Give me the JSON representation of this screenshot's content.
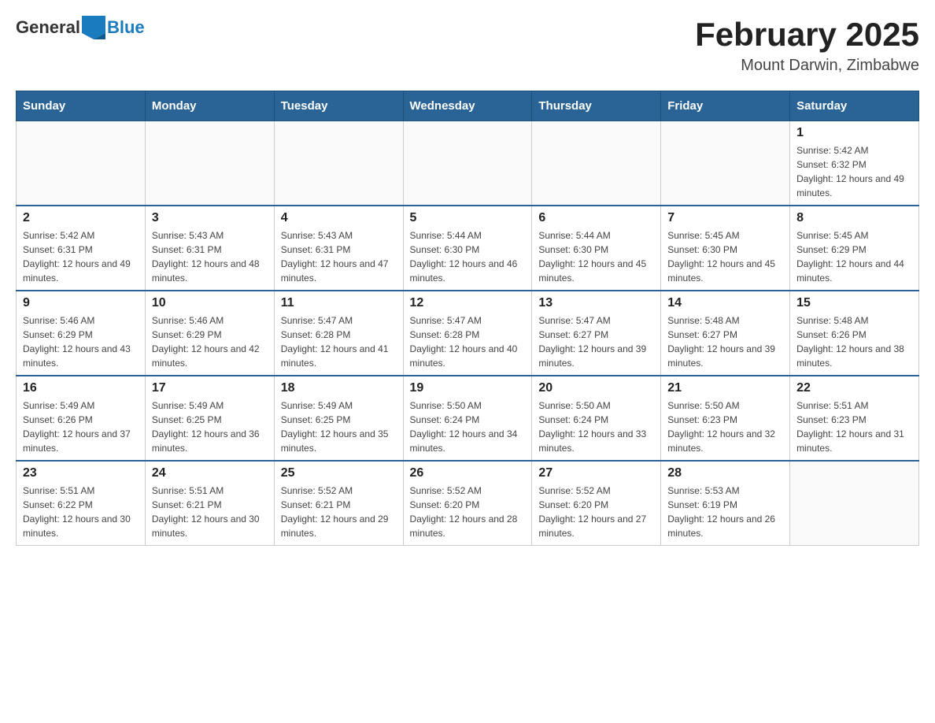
{
  "header": {
    "logo_text_general": "General",
    "logo_text_blue": "Blue",
    "month_year": "February 2025",
    "location": "Mount Darwin, Zimbabwe"
  },
  "days_of_week": [
    "Sunday",
    "Monday",
    "Tuesday",
    "Wednesday",
    "Thursday",
    "Friday",
    "Saturday"
  ],
  "weeks": [
    [
      {
        "day": "",
        "info": ""
      },
      {
        "day": "",
        "info": ""
      },
      {
        "day": "",
        "info": ""
      },
      {
        "day": "",
        "info": ""
      },
      {
        "day": "",
        "info": ""
      },
      {
        "day": "",
        "info": ""
      },
      {
        "day": "1",
        "info": "Sunrise: 5:42 AM\nSunset: 6:32 PM\nDaylight: 12 hours and 49 minutes."
      }
    ],
    [
      {
        "day": "2",
        "info": "Sunrise: 5:42 AM\nSunset: 6:31 PM\nDaylight: 12 hours and 49 minutes."
      },
      {
        "day": "3",
        "info": "Sunrise: 5:43 AM\nSunset: 6:31 PM\nDaylight: 12 hours and 48 minutes."
      },
      {
        "day": "4",
        "info": "Sunrise: 5:43 AM\nSunset: 6:31 PM\nDaylight: 12 hours and 47 minutes."
      },
      {
        "day": "5",
        "info": "Sunrise: 5:44 AM\nSunset: 6:30 PM\nDaylight: 12 hours and 46 minutes."
      },
      {
        "day": "6",
        "info": "Sunrise: 5:44 AM\nSunset: 6:30 PM\nDaylight: 12 hours and 45 minutes."
      },
      {
        "day": "7",
        "info": "Sunrise: 5:45 AM\nSunset: 6:30 PM\nDaylight: 12 hours and 45 minutes."
      },
      {
        "day": "8",
        "info": "Sunrise: 5:45 AM\nSunset: 6:29 PM\nDaylight: 12 hours and 44 minutes."
      }
    ],
    [
      {
        "day": "9",
        "info": "Sunrise: 5:46 AM\nSunset: 6:29 PM\nDaylight: 12 hours and 43 minutes."
      },
      {
        "day": "10",
        "info": "Sunrise: 5:46 AM\nSunset: 6:29 PM\nDaylight: 12 hours and 42 minutes."
      },
      {
        "day": "11",
        "info": "Sunrise: 5:47 AM\nSunset: 6:28 PM\nDaylight: 12 hours and 41 minutes."
      },
      {
        "day": "12",
        "info": "Sunrise: 5:47 AM\nSunset: 6:28 PM\nDaylight: 12 hours and 40 minutes."
      },
      {
        "day": "13",
        "info": "Sunrise: 5:47 AM\nSunset: 6:27 PM\nDaylight: 12 hours and 39 minutes."
      },
      {
        "day": "14",
        "info": "Sunrise: 5:48 AM\nSunset: 6:27 PM\nDaylight: 12 hours and 39 minutes."
      },
      {
        "day": "15",
        "info": "Sunrise: 5:48 AM\nSunset: 6:26 PM\nDaylight: 12 hours and 38 minutes."
      }
    ],
    [
      {
        "day": "16",
        "info": "Sunrise: 5:49 AM\nSunset: 6:26 PM\nDaylight: 12 hours and 37 minutes."
      },
      {
        "day": "17",
        "info": "Sunrise: 5:49 AM\nSunset: 6:25 PM\nDaylight: 12 hours and 36 minutes."
      },
      {
        "day": "18",
        "info": "Sunrise: 5:49 AM\nSunset: 6:25 PM\nDaylight: 12 hours and 35 minutes."
      },
      {
        "day": "19",
        "info": "Sunrise: 5:50 AM\nSunset: 6:24 PM\nDaylight: 12 hours and 34 minutes."
      },
      {
        "day": "20",
        "info": "Sunrise: 5:50 AM\nSunset: 6:24 PM\nDaylight: 12 hours and 33 minutes."
      },
      {
        "day": "21",
        "info": "Sunrise: 5:50 AM\nSunset: 6:23 PM\nDaylight: 12 hours and 32 minutes."
      },
      {
        "day": "22",
        "info": "Sunrise: 5:51 AM\nSunset: 6:23 PM\nDaylight: 12 hours and 31 minutes."
      }
    ],
    [
      {
        "day": "23",
        "info": "Sunrise: 5:51 AM\nSunset: 6:22 PM\nDaylight: 12 hours and 30 minutes."
      },
      {
        "day": "24",
        "info": "Sunrise: 5:51 AM\nSunset: 6:21 PM\nDaylight: 12 hours and 30 minutes."
      },
      {
        "day": "25",
        "info": "Sunrise: 5:52 AM\nSunset: 6:21 PM\nDaylight: 12 hours and 29 minutes."
      },
      {
        "day": "26",
        "info": "Sunrise: 5:52 AM\nSunset: 6:20 PM\nDaylight: 12 hours and 28 minutes."
      },
      {
        "day": "27",
        "info": "Sunrise: 5:52 AM\nSunset: 6:20 PM\nDaylight: 12 hours and 27 minutes."
      },
      {
        "day": "28",
        "info": "Sunrise: 5:53 AM\nSunset: 6:19 PM\nDaylight: 12 hours and 26 minutes."
      },
      {
        "day": "",
        "info": ""
      }
    ]
  ]
}
